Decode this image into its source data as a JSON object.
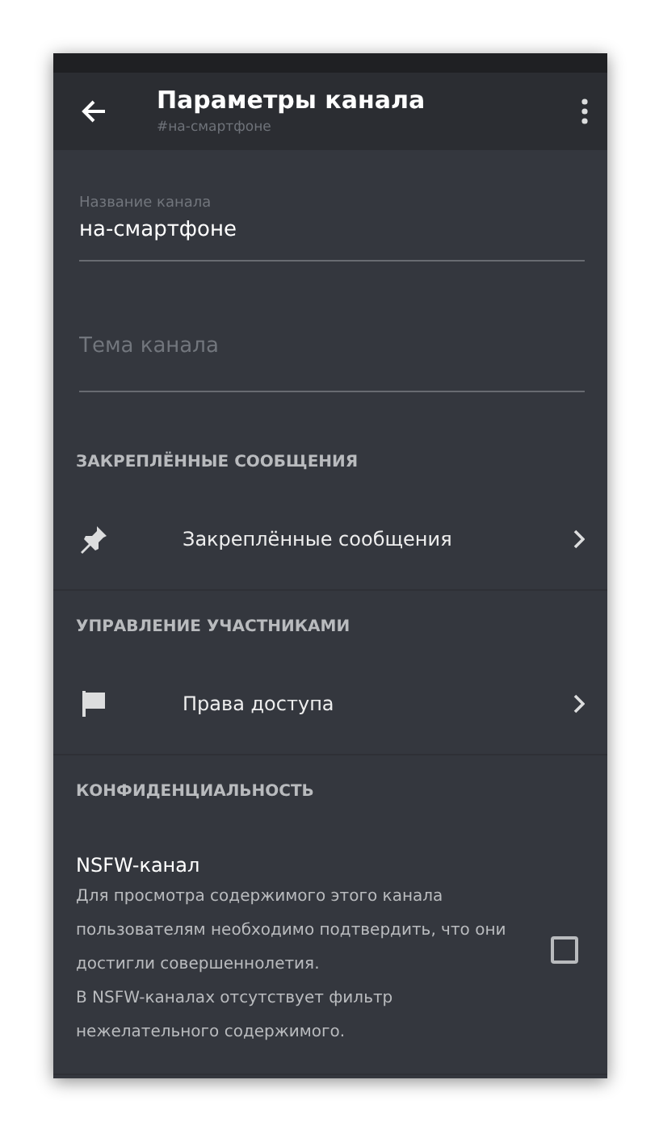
{
  "header": {
    "title": "Параметры канала",
    "subtitle": "#на-смартфоне"
  },
  "fields": [
    {
      "label": "Название канала",
      "value": "на-смартфоне"
    },
    {
      "placeholder": "Тема канала"
    }
  ],
  "sections": [
    {
      "title": "ЗАКРЕПЛЁННЫЕ СООБЩЕНИЯ",
      "items": [
        {
          "kind": "link",
          "label": "Закреплённые сообщения"
        }
      ]
    },
    {
      "title": "УПРАВЛЕНИЕ УЧАСТНИКАМИ",
      "items": [
        {
          "kind": "link",
          "label": "Права доступа"
        }
      ]
    },
    {
      "title": "КОНФИДЕНЦИАЛЬНОСТЬ",
      "items": [
        {
          "kind": "checkbox",
          "label": "NSFW-канал",
          "checked": false,
          "description": [
            "Для просмотра содержимого этого канала пользователям необходимо подтвердить, что они достигли совершеннолетия.",
            "В NSFW-каналах отсутствует фильтр нежелательного содержимого."
          ]
        }
      ]
    }
  ]
}
